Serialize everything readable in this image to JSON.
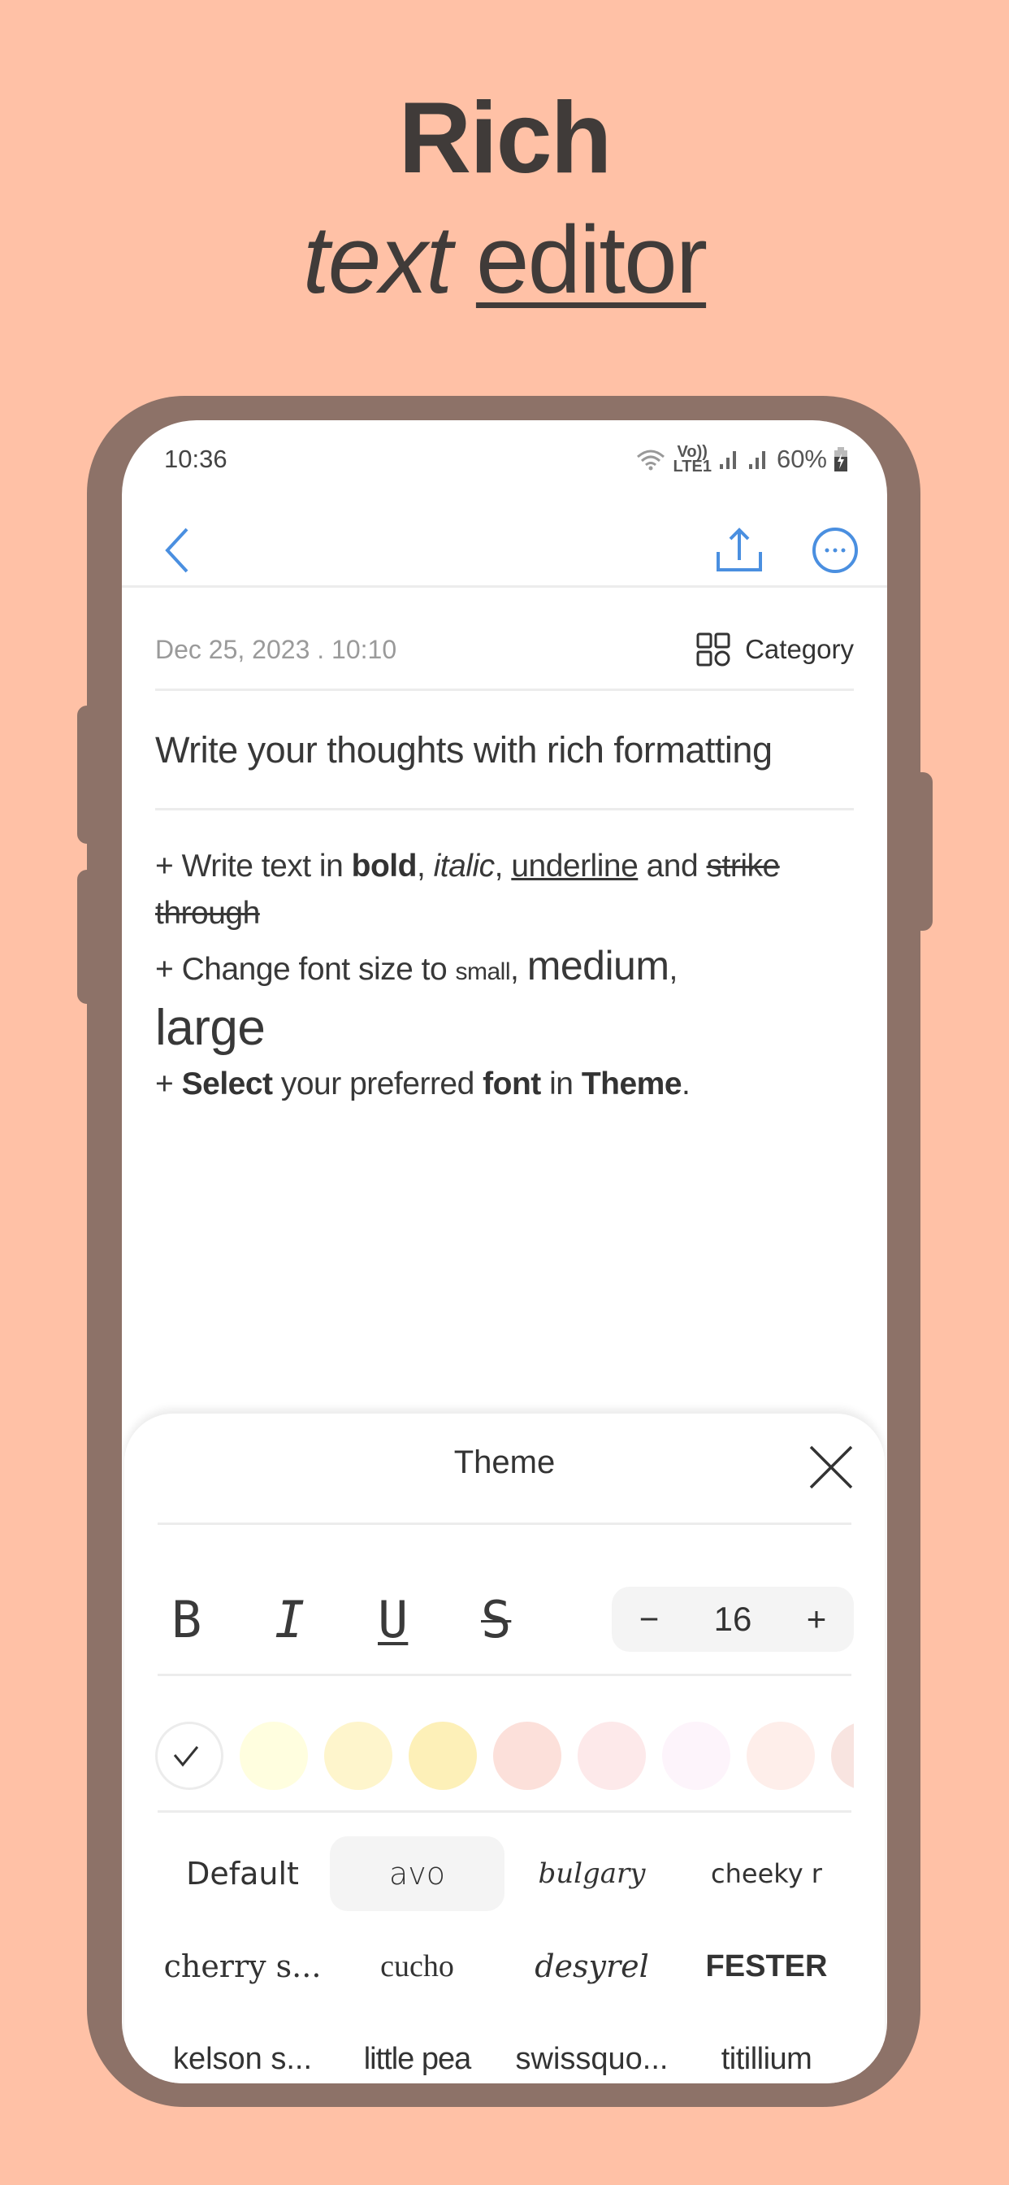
{
  "headline": {
    "line1": "Rich",
    "line2_italic": "text",
    "line2_underline": "editor"
  },
  "status_bar": {
    "time": "10:36",
    "network_top": "Vo))",
    "network_bottom": "LTE1",
    "battery": "60%",
    "icons": [
      "wifi-icon",
      "signal-icon",
      "signal-icon",
      "battery-charging-icon"
    ]
  },
  "toolbar": {
    "back_icon": "chevron-left-icon",
    "share_icon": "share-icon",
    "more_icon": "more-horizontal-icon",
    "accent_color": "#4A8FE0"
  },
  "note": {
    "date": "Dec 25, 2023 . 10:10",
    "category_label": "Category",
    "title": "Write your thoughts with rich formatting",
    "body": {
      "l1_prefix": "+ Write text in ",
      "l1_bold": "bold",
      "l1_comma1": ", ",
      "l1_italic": "italic",
      "l1_comma2": ", ",
      "l1_underline": "underline",
      "l1_and": " and ",
      "l1_strike": "strike through",
      "l2_prefix": "+ Change font size to ",
      "l2_small": "small",
      "l2_comma1": ", ",
      "l2_medium": "medium",
      "l2_comma2": ",",
      "l2_large": "large",
      "l3_prefix": "+ ",
      "l3_select": "Select",
      "l3_mid": " your preferred ",
      "l3_font": "font",
      "l3_in": " in ",
      "l3_theme": "Theme",
      "l3_end": "."
    }
  },
  "theme_panel": {
    "title": "Theme",
    "format_buttons": [
      {
        "label": "B",
        "name": "bold"
      },
      {
        "label": "I",
        "name": "italic"
      },
      {
        "label": "U",
        "name": "underline"
      },
      {
        "label": "S",
        "name": "strikethrough"
      }
    ],
    "font_size": {
      "minus": "−",
      "value": "16",
      "plus": "+"
    },
    "colors": [
      {
        "hex": "#FFFFFF",
        "selected": true
      },
      {
        "hex": "#FFFEDF",
        "selected": false
      },
      {
        "hex": "#FEF5CC",
        "selected": false
      },
      {
        "hex": "#FDF0B8",
        "selected": false
      },
      {
        "hex": "#FCE0DA",
        "selected": false
      },
      {
        "hex": "#FDE9EA",
        "selected": false
      },
      {
        "hex": "#FDF4FB",
        "selected": false
      },
      {
        "hex": "#FEEEEA",
        "selected": false
      },
      {
        "hex": "#F8E4E0",
        "selected": false
      }
    ],
    "fonts": [
      {
        "label": "Default",
        "selected": false
      },
      {
        "label": "avo",
        "selected": true
      },
      {
        "label": "bulgary",
        "selected": false
      },
      {
        "label": "cheeky r",
        "selected": false
      },
      {
        "label": "cherry s...",
        "selected": false
      },
      {
        "label": "cucho",
        "selected": false
      },
      {
        "label": "desyrel",
        "selected": false
      },
      {
        "label": "FESTER",
        "selected": false
      },
      {
        "label": "kelson s...",
        "selected": false
      },
      {
        "label": "little pea",
        "selected": false
      },
      {
        "label": "swissquo...",
        "selected": false
      },
      {
        "label": "titillium",
        "selected": false
      }
    ]
  }
}
